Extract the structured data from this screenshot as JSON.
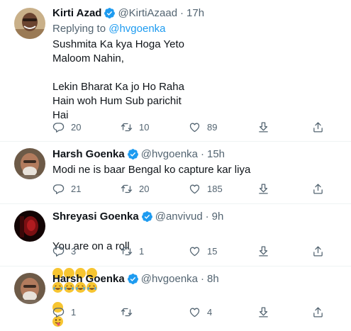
{
  "tweets": [
    {
      "name": "Kirti Azad",
      "handle": "@KirtiAzaad",
      "time": "17h",
      "replying_prefix": "Replying to",
      "replying_to": "@hvgoenka",
      "text": "Sushmita Ka kya Hoga Yeto\nMaloom Nahin,\n\nLekin Bharat Ka jo Ho Raha\nHain woh Hum Sub parichit\nHai",
      "replies": "20",
      "retweets": "10",
      "likes": "89"
    },
    {
      "name": "Harsh Goenka",
      "handle": "@hvgoenka",
      "time": "15h",
      "text": "Modi ne is baar Bengal ko capture kar liya",
      "replies": "21",
      "retweets": "20",
      "likes": "185"
    },
    {
      "name": "Shreyasi Goenka",
      "handle": "@anvivud",
      "time": "9h",
      "text": "You are on a roll",
      "emoji_count": 4,
      "replies": "3",
      "retweets": "1",
      "likes": "15"
    },
    {
      "name": "Harsh Goenka",
      "handle": "@hvgoenka",
      "time": "8h",
      "text": "",
      "emoji_count": 1,
      "replies": "1",
      "retweets": "",
      "likes": "4"
    }
  ],
  "icons": {
    "verified": "verified-badge-icon",
    "reply": "reply-icon",
    "retweet": "retweet-icon",
    "like": "heart-icon",
    "download": "download-icon",
    "share": "share-icon"
  },
  "colors": {
    "brand_blue": "#1d9bf0",
    "muted": "#536471",
    "text": "#0f1419"
  }
}
